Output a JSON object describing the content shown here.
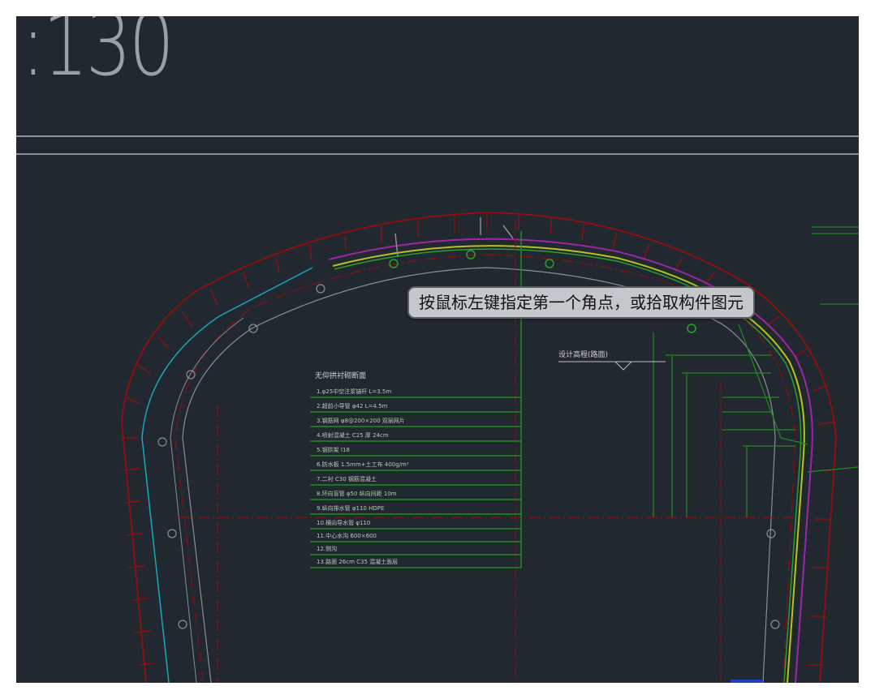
{
  "scale_label": ":130",
  "tooltip_text": "按鼠标左键指定第一个角点，或拾取构件图元",
  "legend": {
    "title": "无仰拱衬砌断面",
    "rows": [
      "1.φ25中空注浆锚杆 L=3.5m",
      "2.超前小导管 φ42 L=4.5m",
      "3.钢筋网 φ8@200×200 双层网片",
      "4.喷射混凝土 C25 厚 24cm",
      "5.钢拱架 I18",
      "6.防水板 1.5mm+土工布 400g/m²",
      "7.二衬 C30 钢筋混凝土",
      "8.环向盲管 φ50 纵向间距 10m",
      "9.纵向排水管 φ110 HDPE",
      "10.横向导水管 φ110",
      "11.中心水沟 600×600",
      "12.侧沟",
      "13.路面 26cm C35 混凝土面层"
    ]
  },
  "elevation_label": "设计高程(路面)",
  "colors": {
    "background": "#212830",
    "red_lines": "#8b1010",
    "green_lines": "#1f8c1f",
    "cyan_lines": "#17a8b8",
    "magenta_lines": "#9c26a6",
    "yellow_lines": "#b6c224",
    "grey_lines": "#8a8f96"
  }
}
